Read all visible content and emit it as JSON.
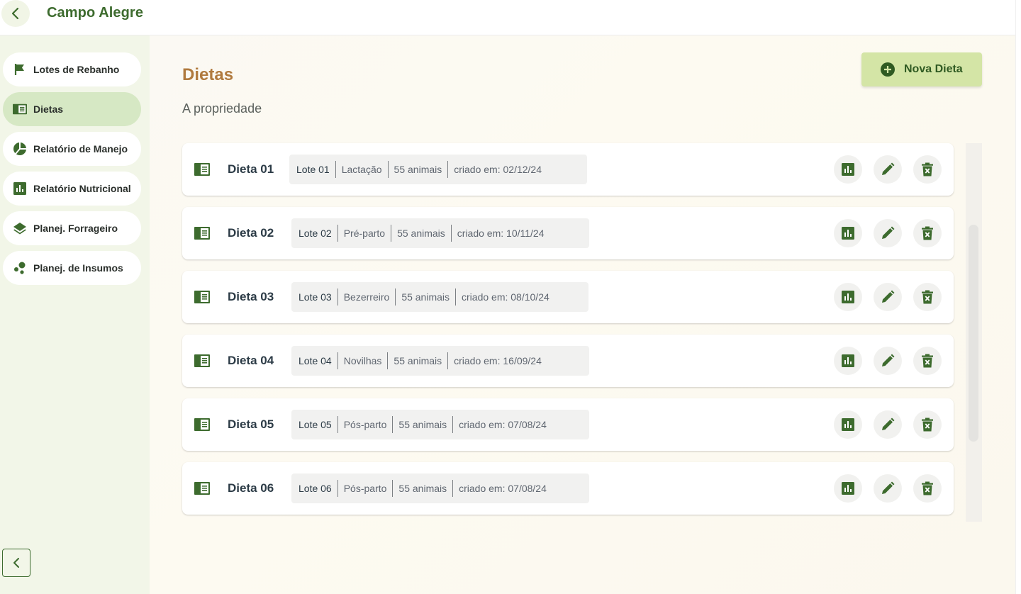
{
  "header": {
    "title": "Campo Alegre"
  },
  "sidebar": {
    "items": [
      {
        "label": "Lotes de Rebanho",
        "icon": "flag-icon"
      },
      {
        "label": "Dietas",
        "icon": "book-icon",
        "active": true
      },
      {
        "label": "Relatório de Manejo",
        "icon": "pie-chart-icon"
      },
      {
        "label": "Relatório Nutricional",
        "icon": "bar-chart-icon"
      },
      {
        "label": "Planej. Forrageiro",
        "icon": "layers-icon"
      },
      {
        "label": "Planej. de Insumos",
        "icon": "bubbles-icon"
      }
    ]
  },
  "main": {
    "title": "Dietas",
    "subtitle": "A propriedade",
    "new_button": "Nova Dieta"
  },
  "diets": [
    {
      "name": "Dieta 01",
      "lote": "Lote 01",
      "categoria": "Lactação",
      "animais": "55 animais",
      "criado": "criado em: 02/12/24"
    },
    {
      "name": "Dieta 02",
      "lote": "Lote 02",
      "categoria": "Pré-parto",
      "animais": "55 animais",
      "criado": "criado em: 10/11/24"
    },
    {
      "name": "Dieta 03",
      "lote": "Lote 03",
      "categoria": "Bezerreiro",
      "animais": "55 animais",
      "criado": "criado em: 08/10/24"
    },
    {
      "name": "Dieta 04",
      "lote": "Lote 04",
      "categoria": "Novilhas",
      "animais": "55 animais",
      "criado": "criado em: 16/09/24"
    },
    {
      "name": "Dieta 05",
      "lote": "Lote 05",
      "categoria": "Pós-parto",
      "animais": "55 animais",
      "criado": "criado em: 07/08/24"
    },
    {
      "name": "Dieta 06",
      "lote": "Lote 06",
      "categoria": "Pós-parto",
      "animais": "55 animais",
      "criado": "criado em: 07/08/24"
    }
  ],
  "colors": {
    "brand_green": "#3d6b2e",
    "accent_brown": "#b07a3e",
    "button_lime": "#d4e5a6",
    "active_nav": "#d6e8c4"
  }
}
